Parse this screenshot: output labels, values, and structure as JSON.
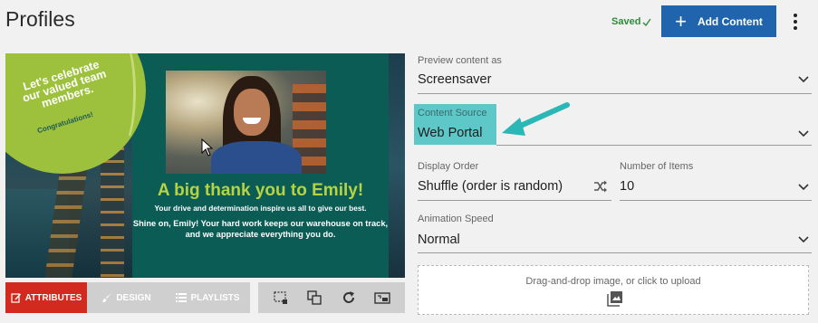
{
  "header": {
    "title": "Profiles",
    "saved_label": "Saved",
    "add_content_label": "Add Content"
  },
  "preview": {
    "badge_text": "Let's celebrate our valued team members.",
    "badge_sub": "Congratulations!",
    "headline": "A big thank you to Emily!",
    "line1": "Your drive and determination inspire us all to give our best.",
    "line2": "Shine on, Emily! Your hard work keeps our warehouse on track, and we appreciate everything you do."
  },
  "tabs": [
    {
      "label": "ATTRIBUTES",
      "active": true
    },
    {
      "label": "DESIGN",
      "active": false
    },
    {
      "label": "PLAYLISTS",
      "active": false
    }
  ],
  "form": {
    "preview_as": {
      "label": "Preview content as",
      "value": "Screensaver"
    },
    "content_source": {
      "label": "Content Source",
      "value": "Web Portal"
    },
    "display_order": {
      "label": "Display Order",
      "value": "Shuffle (order is random)"
    },
    "number_items": {
      "label": "Number of Items",
      "value": "10"
    },
    "animation_speed": {
      "label": "Animation Speed",
      "value": "Normal"
    },
    "upload_text": "Drag-and-drop image, or click to upload"
  },
  "colors": {
    "primary": "#1f64ad",
    "active_tab": "#d32a1f",
    "highlight": "#5ec7c7",
    "saved": "#2e8b3b"
  }
}
